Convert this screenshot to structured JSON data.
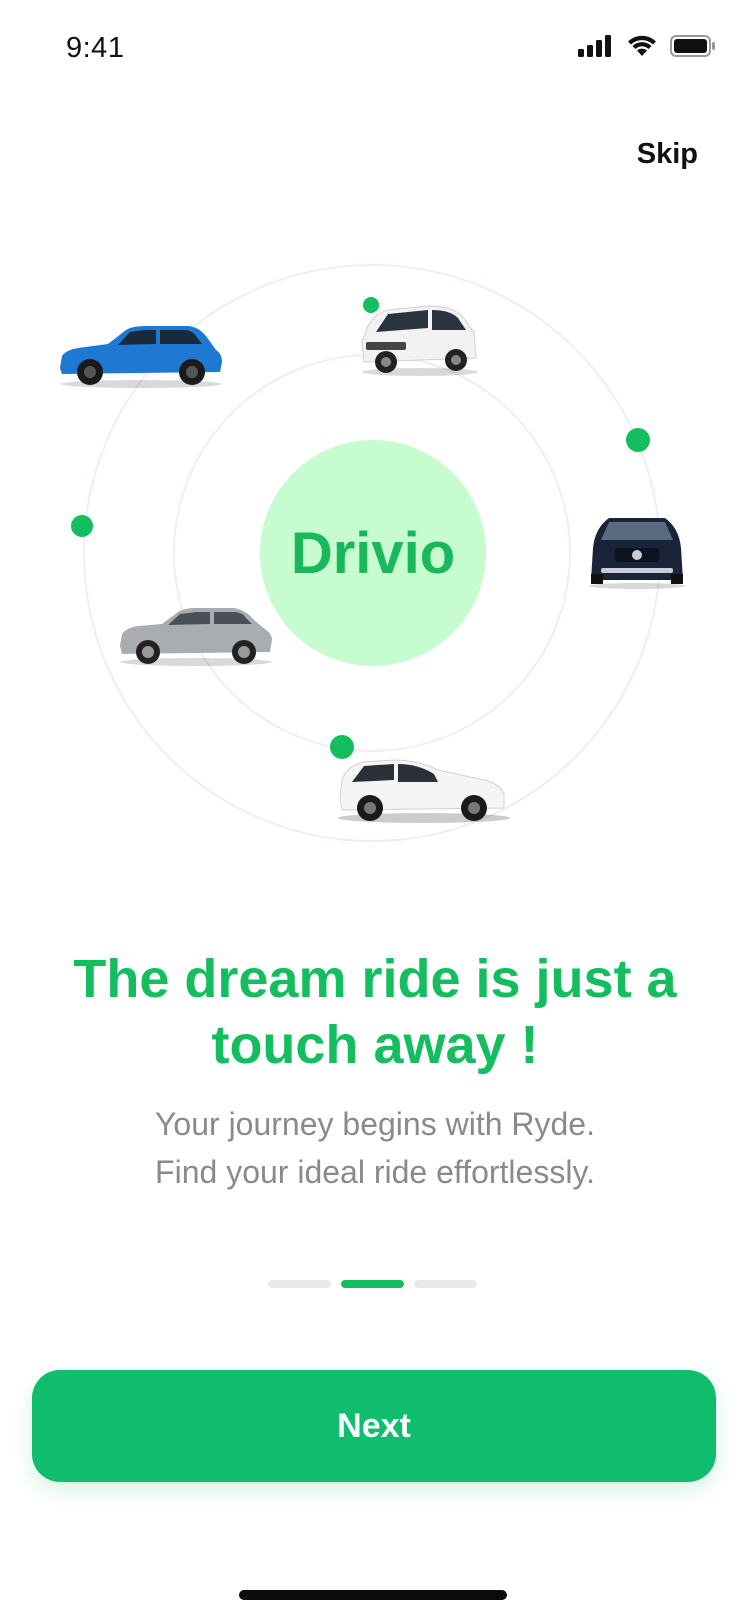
{
  "status_bar": {
    "time": "9:41",
    "icons": [
      "signal-icon",
      "wifi-icon",
      "battery-icon"
    ]
  },
  "header": {
    "skip_label": "Skip"
  },
  "illustration": {
    "center_logo": "Drivio",
    "cars": [
      "blue-suv-icon",
      "white-suv-icon",
      "dark-suv-icon",
      "silver-suv-icon",
      "white-hatchback-icon"
    ],
    "accent_color": "#14bd5e",
    "logo_bg_color": "#c6fcd0"
  },
  "onboarding": {
    "headline_line1": "The dream ride is just a",
    "headline_line2": "touch away !",
    "subtitle_line1": "Your journey begins with Ryde.",
    "subtitle_line2": "Find your ideal ride effortlessly.",
    "current_page": 2,
    "total_pages": 3
  },
  "footer": {
    "next_label": "Next",
    "button_color": "#10bd6d"
  }
}
